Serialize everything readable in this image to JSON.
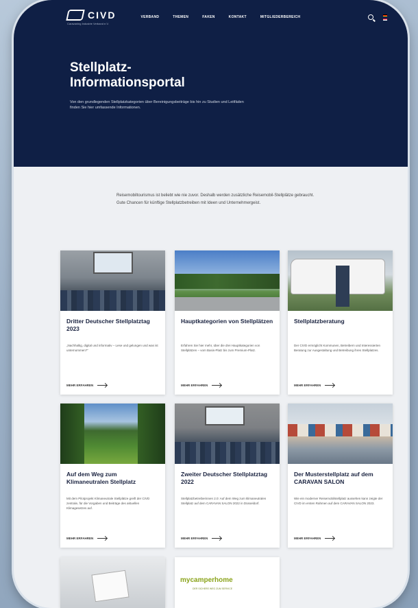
{
  "brand": {
    "name": "CIVD",
    "tagline": "Caravaning Industrie Verband e.V."
  },
  "nav": {
    "items": [
      "VERBAND",
      "THEMEN",
      "FAKEN",
      "KONTAKT",
      "MITGLIEDERBEREICH"
    ]
  },
  "colors": {
    "hero_bg": "#0f1f45",
    "page_bg": "#eef0f3",
    "brand_green": "#8aa31a"
  },
  "hero": {
    "title_line1": "Stellplatz-",
    "title_line2": "Informationsportal",
    "description": "Von den grundlegenden Stellplatzkategorien über Bereinigungsbeiträge bis hin zu Studien und Leitfäden finden Sie hier umfassende Informationen."
  },
  "intro": "Reisemobiltourismus ist beliebt wie nie zuvor. Deshalb werden zusätzliche Reisemobil-Stellplätze gebraucht. Gute Chancen für künftige Stellplatzbetreiben mit Ideen und Unternehmergeist.",
  "cards": [
    {
      "title": "Dritter Deutscher Stellplatztag 2023",
      "desc": "„Nachhaltig, digital und informativ – Lese und gelungen und was ist unternommen?“",
      "more": "MEHR ERFAHREN"
    },
    {
      "title": "Hauptkategorien von Stellplätzen",
      "desc": "Erfahren Sie hier mehr, über die drei Hauptkategorien von Stellplätzen – vom Basis-Platz bis zum Premium-Platz.",
      "more": "MEHR ERFAHREN"
    },
    {
      "title": "Stellplatzberatung",
      "desc": "Der CIVD ermöglicht Kommunen, Betreibern und Interessierten Beratung zur Ausgestaltung und Betreibung ihres Stellplatzes.",
      "more": "MEHR ERFAHREN"
    },
    {
      "title": "Auf dem Weg zum Klimaneutralen Stellplatz",
      "desc": "Mit dem Pilotprojekt Klimaneutrale Stellplätze greift der CIVD zentrale, für die Vorgaben und Beiträge des aktuellen Klimagesetzes auf.",
      "more": "MEHR ERFAHREN"
    },
    {
      "title": "Zweiter Deutscher Stellplatztag 2022",
      "desc": "Stellplatzbetreiberinnen 2.0: Auf dem Weg zum klimaneutralen Stellplatz auf dem CARAVAN SALON 2022 in Düsseldorf.",
      "more": "MEHR ERFAHREN"
    },
    {
      "title": "Der Musterstellplatz auf dem CARAVAN SALON",
      "desc": "Wie ein moderner Reisemobilstellplatz aussehen kann zeigte der CIVD im ersten Rahmen auf dem CARAVAN SALON 2023.",
      "more": "MEHR ERFAHREN"
    }
  ],
  "partner": {
    "name": "mycamperhome",
    "sub": "DER SICHERE WEG ZUM SERVICE"
  }
}
